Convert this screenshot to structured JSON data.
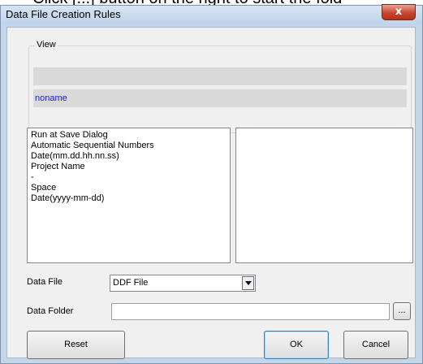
{
  "overlay_text": "Click [...] button on the right to start the fold",
  "window": {
    "title": "Data File Creation Rules",
    "close_label": "x"
  },
  "view": {
    "group_label": "View",
    "line1": "",
    "line2": "noname"
  },
  "left_list": {
    "items": [
      "Run at Save Dialog",
      "Automatic Sequential Numbers",
      "Date(mm.dd.hh.nn.ss)",
      "Project Name",
      "-",
      "Space",
      "Date(yyyy-mm-dd)"
    ]
  },
  "right_list": {
    "items": []
  },
  "data_file": {
    "label": "Data File",
    "selected": "DDF File"
  },
  "data_folder": {
    "label": "Data Folder",
    "value": "",
    "browse_label": "..."
  },
  "buttons": {
    "reset": "Reset",
    "ok": "OK",
    "cancel": "Cancel"
  },
  "colors": {
    "title_bar": "#c4d6ea",
    "close_button": "#c9452e",
    "view_text": "#1c1ccc",
    "client_background": "#f0f0f0"
  }
}
